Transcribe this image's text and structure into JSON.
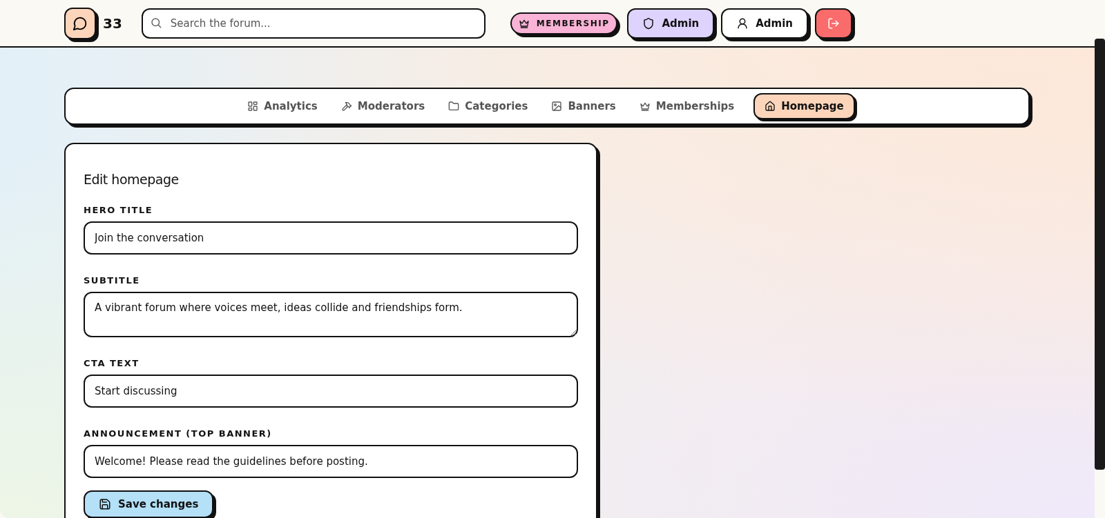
{
  "header": {
    "badge_count": "33",
    "search": {
      "placeholder": "Search the forum..."
    },
    "buttons": [
      {
        "kind": "membership",
        "label": "MEMBERSHIP"
      },
      {
        "kind": "admin",
        "label": "Admin"
      },
      {
        "kind": "user",
        "label": "Admin"
      },
      {
        "kind": "logout"
      }
    ]
  },
  "tabs": [
    {
      "label": "Analytics",
      "selected": false
    },
    {
      "label": "Moderators",
      "selected": false
    },
    {
      "label": "Categories",
      "selected": false
    },
    {
      "label": "Banners",
      "selected": false
    },
    {
      "label": "Memberships",
      "selected": false
    },
    {
      "label": "Homepage",
      "selected": true
    }
  ],
  "form": {
    "title": "Edit homepage",
    "fields": [
      {
        "kind": "input",
        "label": "HERO TITLE",
        "value": "Join the conversation"
      },
      {
        "kind": "textarea",
        "label": "SUBTITLE",
        "value": "A vibrant forum where voices meet, ideas collide and friendships form."
      },
      {
        "kind": "input",
        "label": "CTA TEXT",
        "value": "Start discussing"
      },
      {
        "kind": "input",
        "label": "ANNOUNCEMENT (TOP BANNER)",
        "value": "Welcome! Please read the guidelines before posting."
      }
    ],
    "save_button": "Save changes"
  }
}
